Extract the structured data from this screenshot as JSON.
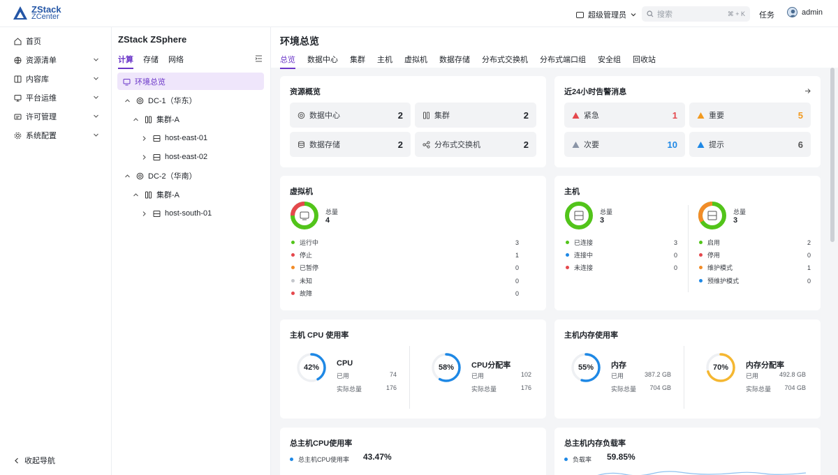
{
  "app": {
    "logo_line1": "ZStack",
    "logo_line2": "ZCenter"
  },
  "header": {
    "role": "超级管理员",
    "search_placeholder": "搜索",
    "search_shortcut": "⌘ + K",
    "tasks": "任务",
    "user": "admin"
  },
  "nav": {
    "items": [
      {
        "label": "首页",
        "icon": "home-icon",
        "has_children": false
      },
      {
        "label": "资源清单",
        "icon": "globe-icon",
        "has_children": true
      },
      {
        "label": "内容库",
        "icon": "book-icon",
        "has_children": true
      },
      {
        "label": "平台运维",
        "icon": "monitor-icon",
        "has_children": true
      },
      {
        "label": "许可管理",
        "icon": "license-icon",
        "has_children": true
      },
      {
        "label": "系统配置",
        "icon": "gear-icon",
        "has_children": true
      }
    ],
    "collapse": "收起导航"
  },
  "tree": {
    "title": "ZStack ZSphere",
    "tabs": [
      "计算",
      "存储",
      "网络"
    ],
    "selected": "环境总览",
    "nodes": {
      "dc1": "DC-1（华东）",
      "cluster1": "集群-A",
      "host1": "host-east-01",
      "host2": "host-east-02",
      "dc2": "DC-2（华南）",
      "cluster2": "集群-A",
      "host3": "host-south-01"
    }
  },
  "main": {
    "title": "环境总览",
    "tabs": [
      "总览",
      "数据中心",
      "集群",
      "主机",
      "虚拟机",
      "数据存储",
      "分布式交换机",
      "分布式端口组",
      "安全组",
      "回收站"
    ],
    "active_tab": "总览"
  },
  "resource_overview": {
    "title": "资源概览",
    "tiles": [
      {
        "label": "数据中心",
        "value": "2",
        "icon": "datacenter-icon"
      },
      {
        "label": "集群",
        "value": "2",
        "icon": "cluster-icon"
      },
      {
        "label": "数据存储",
        "value": "2",
        "icon": "storage-icon"
      },
      {
        "label": "分布式交换机",
        "value": "2",
        "icon": "switch-icon"
      }
    ]
  },
  "alerts": {
    "title": "近24小时告警消息",
    "tiles": [
      {
        "label": "紧急",
        "value": "1",
        "color": "#e5484d"
      },
      {
        "label": "重要",
        "value": "5",
        "color": "#f29a1f"
      },
      {
        "label": "次要",
        "value": "10",
        "color": "#1e88e5"
      },
      {
        "label": "提示",
        "value": "6",
        "color": "#1f2329"
      }
    ]
  },
  "vm": {
    "title": "虚拟机",
    "total_label": "总量",
    "total": "4",
    "rows": [
      {
        "label": "运行中",
        "value": "3",
        "color": "#52c41a"
      },
      {
        "label": "停止",
        "value": "1",
        "color": "#e5484d"
      },
      {
        "label": "已暂停",
        "value": "0",
        "color": "#f28c28"
      },
      {
        "label": "未知",
        "value": "0",
        "color": "#c4c7cc"
      },
      {
        "label": "故障",
        "value": "0",
        "color": "#e5484d"
      }
    ]
  },
  "host": {
    "title": "主机",
    "connection": {
      "total_label": "总量",
      "total": "3",
      "rows": [
        {
          "label": "已连接",
          "value": "3",
          "color": "#52c41a"
        },
        {
          "label": "连接中",
          "value": "0",
          "color": "#1e88e5"
        },
        {
          "label": "未连接",
          "value": "0",
          "color": "#e5484d"
        }
      ]
    },
    "state": {
      "total_label": "总量",
      "total": "3",
      "rows": [
        {
          "label": "启用",
          "value": "2",
          "color": "#52c41a"
        },
        {
          "label": "停用",
          "value": "0",
          "color": "#e5484d"
        },
        {
          "label": "维护模式",
          "value": "1",
          "color": "#f28c28"
        },
        {
          "label": "预维护模式",
          "value": "0",
          "color": "#1e88e5"
        }
      ]
    }
  },
  "cpu_usage": {
    "title": "主机 CPU 使用率",
    "gauges": [
      {
        "name": "CPU",
        "percent": 42,
        "percent_label": "42%",
        "used_label": "已用",
        "used": "74",
        "total_label": "实际总量",
        "total": "176",
        "color": "#1e88e5"
      },
      {
        "name": "CPU分配率",
        "percent": 58,
        "percent_label": "58%",
        "used_label": "已用",
        "used": "102",
        "total_label": "实际总量",
        "total": "176",
        "color": "#1e88e5"
      }
    ]
  },
  "mem_usage": {
    "title": "主机内存使用率",
    "gauges": [
      {
        "name": "内存",
        "percent": 55,
        "percent_label": "55%",
        "used_label": "已用",
        "used": "387.2 GB",
        "total_label": "实际总量",
        "total": "704 GB",
        "color": "#1e88e5"
      },
      {
        "name": "内存分配率",
        "percent": 70,
        "percent_label": "70%",
        "used_label": "已用",
        "used": "492.8 GB",
        "total_label": "实际总量",
        "total": "704 GB",
        "color": "#f5b731"
      }
    ]
  },
  "total_cpu": {
    "title": "总主机CPU使用率",
    "legend": "总主机CPU使用率",
    "value": "43.47%"
  },
  "total_mem": {
    "title": "总主机内存负载率",
    "legend": "负载率",
    "value": "59.85%"
  }
}
